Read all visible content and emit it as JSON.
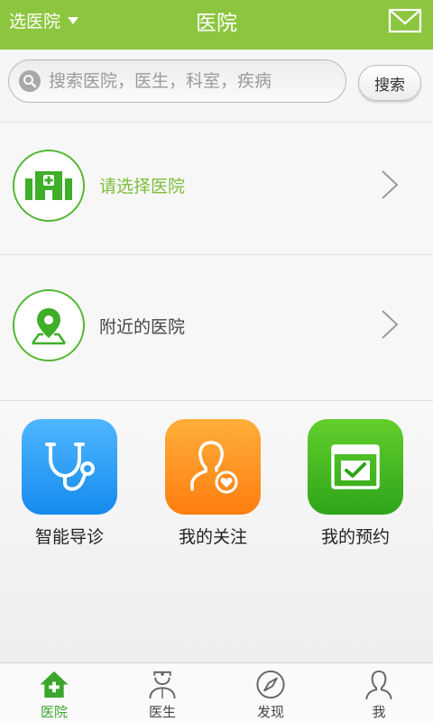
{
  "header": {
    "select_label": "选医院",
    "title": "医院"
  },
  "search": {
    "placeholder": "搜索医院，医生，科室，疾病",
    "button_label": "搜索"
  },
  "rows": [
    {
      "label": "请选择医院",
      "icon": "hospital-icon"
    },
    {
      "label": "附近的医院",
      "icon": "location-pin-icon"
    }
  ],
  "tiles": [
    {
      "label": "智能导诊",
      "icon": "stethoscope-icon"
    },
    {
      "label": "我的关注",
      "icon": "person-heart-icon"
    },
    {
      "label": "我的预约",
      "icon": "calendar-check-icon"
    }
  ],
  "tabs": [
    {
      "label": "医院",
      "icon": "hospital-house-icon",
      "active": true
    },
    {
      "label": "医生",
      "icon": "doctor-icon",
      "active": false
    },
    {
      "label": "发现",
      "icon": "compass-icon",
      "active": false
    },
    {
      "label": "我",
      "icon": "user-icon",
      "active": false
    }
  ],
  "colors": {
    "header_green": "#8cc63f",
    "accent_green": "#52b733",
    "tile_blue": "#168aee",
    "tile_orange": "#ff7e10",
    "tile_green": "#2ea419"
  }
}
